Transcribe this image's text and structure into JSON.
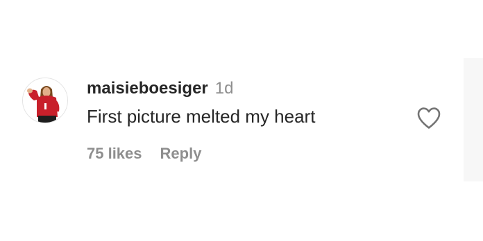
{
  "comment": {
    "username": "maisieboesiger",
    "timestamp": "1d",
    "text": "First picture melted my heart",
    "likes_label": "75 likes",
    "reply_label": "Reply",
    "heart_icon": "heart-outline-icon",
    "avatar": "profile-photo"
  },
  "colors": {
    "primary_text": "#262626",
    "secondary_text": "#8e8e8e",
    "background": "#ffffff"
  }
}
